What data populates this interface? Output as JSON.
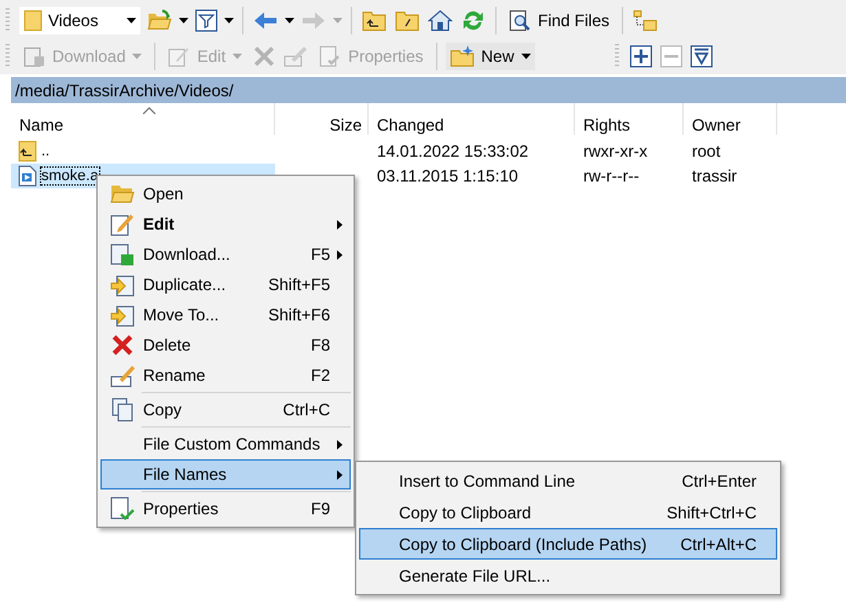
{
  "toolbar_1": {
    "location": "Videos",
    "find_files": "Find Files",
    "back_disabled": false,
    "forward_disabled": true
  },
  "toolbar_2": {
    "download": {
      "label": "Download",
      "disabled": true
    },
    "edit": {
      "label": "Edit",
      "disabled": true
    },
    "delete_disabled": true,
    "rename_disabled": true,
    "properties": {
      "label": "Properties",
      "disabled": true
    },
    "new": {
      "label": "New",
      "disabled": false
    },
    "collapse_disabled": true
  },
  "path": "/media/TrassirArchive/Videos/",
  "table": {
    "columns": [
      "Name",
      "Size",
      "Changed",
      "Rights",
      "Owner"
    ],
    "rows": [
      {
        "kind": "parent",
        "name": "..",
        "size": "",
        "changed": "14.01.2022 15:33:02",
        "rights": "rwxr-xr-x",
        "owner": "root",
        "selected": false
      },
      {
        "kind": "file",
        "name": "smoke.a",
        "size": "",
        "changed": "03.11.2015 1:15:10",
        "rights": "rw-r--r--",
        "owner": "trassir",
        "selected": true
      }
    ]
  },
  "context_menu": {
    "items": [
      {
        "kind": "item",
        "label": "Open",
        "bold": false,
        "submenu": false,
        "selected": false
      },
      {
        "kind": "item",
        "label": "Edit",
        "bold": true,
        "submenu": true,
        "selected": false
      },
      {
        "kind": "item",
        "label": "Download...",
        "shortcut": "F5",
        "bold": false,
        "submenu": true,
        "selected": false
      },
      {
        "kind": "item",
        "label": "Duplicate...",
        "shortcut": "Shift+F5",
        "bold": false,
        "submenu": false,
        "selected": false
      },
      {
        "kind": "item",
        "label": "Move To...",
        "shortcut": "Shift+F6",
        "bold": false,
        "submenu": false,
        "selected": false
      },
      {
        "kind": "item",
        "label": "Delete",
        "shortcut": "F8",
        "bold": false,
        "submenu": false,
        "selected": false
      },
      {
        "kind": "item",
        "label": "Rename",
        "shortcut": "F2",
        "bold": false,
        "submenu": false,
        "selected": false
      },
      {
        "kind": "separator"
      },
      {
        "kind": "item",
        "label": "Copy",
        "shortcut": "Ctrl+C",
        "bold": false,
        "submenu": false,
        "selected": false
      },
      {
        "kind": "separator"
      },
      {
        "kind": "item",
        "label": "File Custom Commands",
        "bold": false,
        "submenu": true,
        "selected": false
      },
      {
        "kind": "item",
        "label": "File Names",
        "bold": false,
        "submenu": true,
        "selected": true
      },
      {
        "kind": "separator"
      },
      {
        "kind": "item",
        "label": "Properties",
        "shortcut": "F9",
        "bold": false,
        "submenu": false,
        "selected": false
      }
    ]
  },
  "submenu": {
    "items": [
      {
        "label": "Insert to Command Line",
        "shortcut": "Ctrl+Enter",
        "selected": false
      },
      {
        "label": "Copy to Clipboard",
        "shortcut": "Shift+Ctrl+C",
        "selected": false
      },
      {
        "label": "Copy to Clipboard (Include Paths)",
        "shortcut": "Ctrl+Alt+C",
        "selected": true
      },
      {
        "label": "Generate File URL...",
        "selected": false
      }
    ]
  }
}
